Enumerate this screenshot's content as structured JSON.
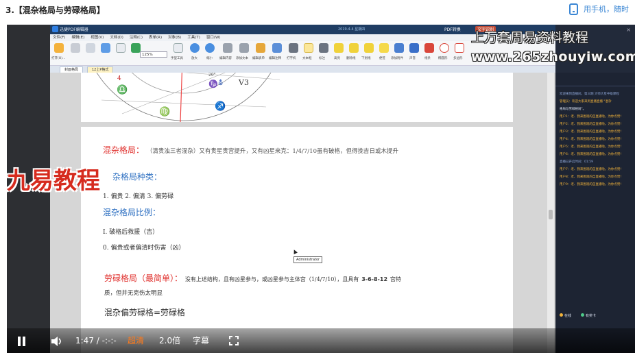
{
  "course": {
    "lesson_title": "3.【混杂格局与劳碌格局】",
    "mobile_link": "用手机，随时"
  },
  "app": {
    "title": "迅捷PDF编辑器",
    "menu": [
      "文件(F)",
      "编辑(E)",
      "视图(V)",
      "文档(D)",
      "注释(C)",
      "表单(R)",
      "对象(B)",
      "工具(T)",
      "窗口(W)"
    ],
    "date_label": "2019-4-4 星期四",
    "pdf_convert_label": "PDF转换",
    "translate_label": "文字识别",
    "zoom": "125%",
    "ribbon_labels": [
      "打开(O)...",
      "手型工具",
      "选择",
      "放大",
      "缩小",
      "编辑内容",
      "添加文本",
      "编辑表单",
      "编辑注释",
      "打字机",
      "文本框",
      "标注",
      "高亮",
      "删除线",
      "下划线",
      "便签",
      "添加附件",
      "声音",
      "线条",
      "椭圆形",
      "多边形",
      "矩形",
      "云朵"
    ],
    "tabs": [
      "封面格局",
      "12上P格式"
    ]
  },
  "document": {
    "top_page": {
      "symbols": [
        "♎",
        "♍",
        "♐",
        "♑",
        "⛢",
        "♄"
      ],
      "marks": [
        "V3",
        "20°"
      ]
    },
    "p1_heading": "混杂格局：",
    "p1_body": "（清贵浊三者混杂）又有贵星贵宫提升，又有凶星来克：1/4/7/10虽有破格，但得挽吉日或木提升",
    "types_heading": "杂格局种类：",
    "types_list": "1. 偏贵  2. 偏清  3. 偏劳碌",
    "ratio_heading": "混杂格局比例：",
    "ratio_item1": "I. 破格后救援（吉）",
    "ratio_item2": "0. 偏贵或者偏清时伤害（凶）",
    "tooltip": "Administrator",
    "laolu_heading": "劳碌格局（最简单）：",
    "laolu_body": "没有上述结构，且有凶星参与，或凶星参与主体宫（1/4/7/10），且具有",
    "laolu_bold": "3-6-8-12",
    "laolu_tail": "宫特",
    "laolu_body2": "质，但并无克伤太明显",
    "laolu_eq": "混杂偏劳碌格=劳碌格"
  },
  "chat": {
    "close": "×",
    "messages": [
      {
        "kind": "sys",
        "text": "欢迎来到直播间，第三期 大师大星中级课程"
      },
      {
        "kind": "user",
        "text": "管理员：欢迎大家来到直播直播 \"混杂"
      },
      {
        "kind": "white",
        "text": "格局与劳碌格局\"。"
      },
      {
        "kind": "user",
        "text": "用户1：老、我来围观的自直播啦。为你点赞!"
      },
      {
        "kind": "user",
        "text": "用户2：老、我来围观的自直播啦。为你点赞!"
      },
      {
        "kind": "user",
        "text": "用户3：老、我来围观的自直播啦。为你点赞!"
      },
      {
        "kind": "user",
        "text": "用户4：老、我来围观的自直播啦。为你点赞!"
      },
      {
        "kind": "user",
        "text": "用户5：老、我来围观的自直播啦。为你点赞!"
      },
      {
        "kind": "user",
        "text": "用户6：老、我来围观的自直播啦。为你点赞!"
      },
      {
        "kind": "sys",
        "text": "直播已开启时间：01:59"
      },
      {
        "kind": "user",
        "text": "用户7：老、我来围观的自直播啦。为你点赞!"
      },
      {
        "kind": "user",
        "text": "用户8：老、我来围观的自直播啦。为你点赞!"
      },
      {
        "kind": "user",
        "text": "用户9：老、我来围观的自直播啦。为你点赞!"
      }
    ],
    "footer_left": "在线",
    "footer_right": "有奖卡"
  },
  "watermarks": {
    "line1": "上万套周易资料教程",
    "line2": "www.265zhouyiw.com",
    "line3": "九易教程"
  },
  "player": {
    "time": "1:47 / -:-:-",
    "quality": "超清",
    "speed": "2.0倍",
    "subtitles": "字幕",
    "accent_color": "#ff7a1a"
  }
}
